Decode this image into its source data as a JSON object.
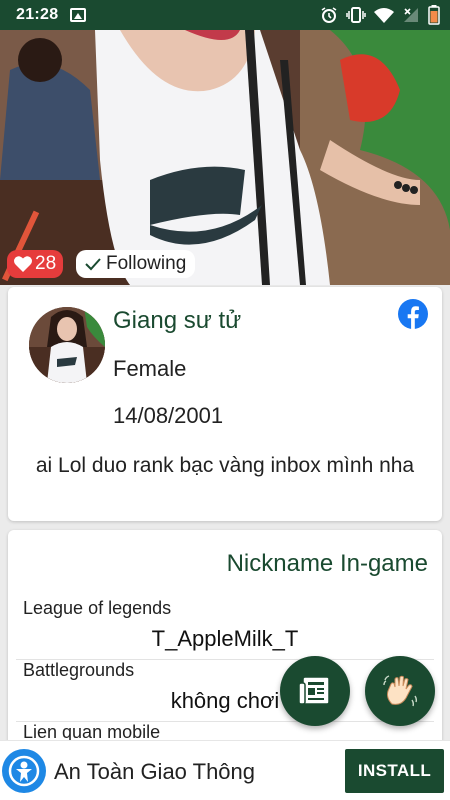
{
  "status_bar": {
    "time": "21:28",
    "icons": [
      "image-icon",
      "alarm-icon",
      "vibrate-icon",
      "wifi-icon",
      "no-signal-icon",
      "battery-icon"
    ]
  },
  "hero": {
    "image": "profile-photo",
    "likes": "28",
    "follow_label": "Following"
  },
  "profile": {
    "name": "Giang sư tử",
    "gender": "Female",
    "birthday": "14/08/2001",
    "bio": "ai Lol duo rank bạc vàng inbox mình nha",
    "social_icon": "facebook-icon"
  },
  "nickname_section": {
    "title": "Nickname In-game",
    "games": [
      {
        "game": "League of legends",
        "nickname": "T_AppleMilk_T"
      },
      {
        "game": "Battlegrounds",
        "nickname": "không chơi"
      },
      {
        "game": "Lien quan mobile",
        "nickname": ""
      }
    ]
  },
  "fab": {
    "article_icon": "article-icon",
    "wave_icon": "wave-hand-icon"
  },
  "ad": {
    "title": "An Toàn Giao Thông",
    "install_label": "INSTALL",
    "logo_icon": "traffic-safety-logo-icon"
  },
  "colors": {
    "primary": "#1a4a30",
    "like_red": "#e63c3c",
    "facebook_blue": "#1877f2"
  }
}
